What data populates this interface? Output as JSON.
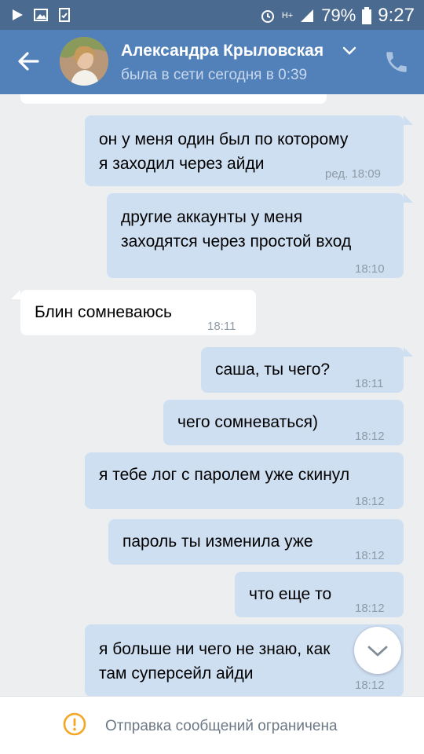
{
  "status_bar": {
    "battery": "79%",
    "time": "9:27",
    "signal_label": "H+"
  },
  "header": {
    "name": "Александра Крыловская",
    "status": "была в сети сегодня в 0:39"
  },
  "messages": [
    {
      "dir": "out",
      "text": "он у меня один был по которому\nя заходил через айди",
      "time": "ред. 18:09"
    },
    {
      "dir": "out",
      "text": "другие аккаунты у меня\nзаходятся через простой вход",
      "time": "18:10"
    },
    {
      "dir": "in",
      "text": "Блин сомневаюсь",
      "time": "18:11"
    },
    {
      "dir": "out",
      "text": "саша, ты чего?",
      "time": "18:11"
    },
    {
      "dir": "out",
      "text": "чего сомневаться)",
      "time": "18:12"
    },
    {
      "dir": "out",
      "text": "я тебе лог с паролем уже скинул",
      "time": "18:12"
    },
    {
      "dir": "out",
      "text": "пароль ты изменила уже",
      "time": "18:12"
    },
    {
      "dir": "out",
      "text": "что еще то",
      "time": "18:12"
    },
    {
      "dir": "out",
      "text": "я больше ни чего не знаю, как\nтам суперсейл айди",
      "time": "18:12"
    }
  ],
  "footer": {
    "notice": "Отправка сообщений ограничена"
  },
  "colors": {
    "header": "#5181b8",
    "status_bar": "#4a6a90",
    "out_bubble": "#cfdff2",
    "in_bubble": "#ffffff",
    "background": "#edeef0",
    "warning": "#f5a623"
  }
}
